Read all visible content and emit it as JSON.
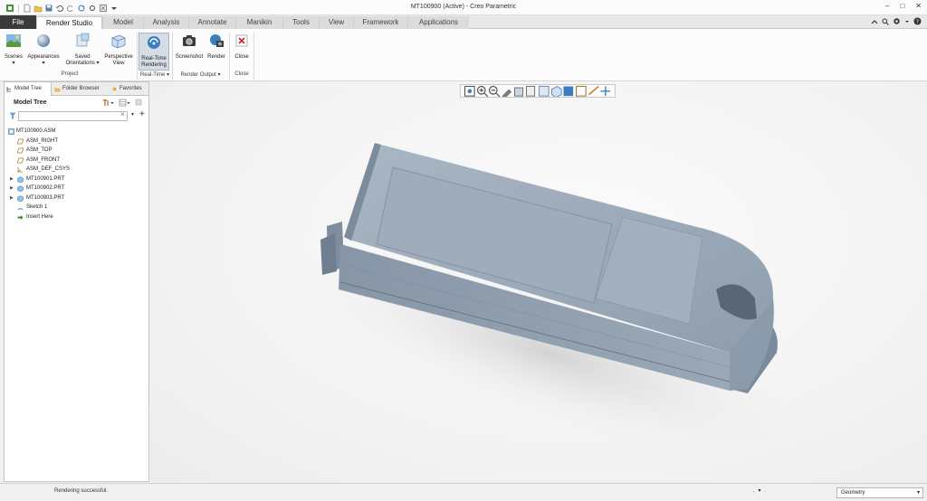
{
  "window": {
    "title": "MT100900 (Active) - Creo Parametric"
  },
  "tabs": [
    {
      "label": "File"
    },
    {
      "label": "Render Studio"
    },
    {
      "label": "Model"
    },
    {
      "label": "Analysis"
    },
    {
      "label": "Annotate"
    },
    {
      "label": "Manikin"
    },
    {
      "label": "Tools"
    },
    {
      "label": "View"
    },
    {
      "label": "Framework"
    },
    {
      "label": "Applications"
    }
  ],
  "ribbon": {
    "scenes": "Scenes",
    "appearances": "Appearances",
    "saved_orientations_1": "Saved",
    "saved_orientations_2": "Orientations",
    "perspective_1": "Perspective",
    "perspective_2": "View",
    "realtime_1": "Real-Time",
    "realtime_2": "Rendering",
    "screenshot": "Screenshot",
    "render": "Render",
    "close": "Close",
    "group_project": "Project",
    "group_realtime": "Real-Time",
    "group_render_output": "Render Output",
    "group_close": "Close"
  },
  "panel": {
    "tab_model_tree": "Model Tree",
    "tab_folder_browser": "Folder Browser",
    "tab_favorites": "Favorites",
    "title": "Model Tree",
    "tree": [
      "MT100900.ASM",
      "ASM_RIGHT",
      "ASM_TOP",
      "ASM_FRONT",
      "ASM_DEF_CSYS",
      "MT100901.PRT",
      "MT100902.PRT",
      "MT100903.PRT",
      "Sketch 1",
      "Insert Here"
    ]
  },
  "status": {
    "message": "Rendering successful.",
    "filter_value": "Geometry"
  },
  "colors": {
    "accent": "#3a7ebf",
    "file_tab": "#3b3b3b",
    "model": "#95a4b5"
  }
}
